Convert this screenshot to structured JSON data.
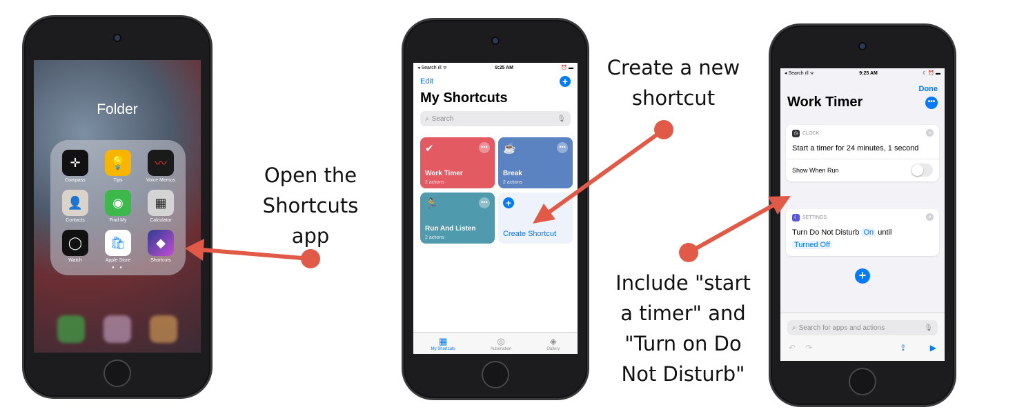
{
  "phone1": {
    "folder_title": "Folder",
    "apps": [
      {
        "label": "Compass",
        "icon": "compass-icon"
      },
      {
        "label": "Tips",
        "icon": "lightbulb-icon"
      },
      {
        "label": "Voice Memos",
        "icon": "waveform-icon"
      },
      {
        "label": "Contacts",
        "icon": "contacts-icon"
      },
      {
        "label": "Find My",
        "icon": "find-my-icon"
      },
      {
        "label": "Calculator",
        "icon": "calculator-icon"
      },
      {
        "label": "Watch",
        "icon": "watch-icon"
      },
      {
        "label": "Apple Store",
        "icon": "shopping-bag-icon"
      },
      {
        "label": "Shortcuts",
        "icon": "shortcuts-icon"
      }
    ]
  },
  "phone2": {
    "status": {
      "left": "◂ Search ıll ᯤ",
      "time": "9:25 AM",
      "right": "⏰ ▬"
    },
    "edit_label": "Edit",
    "title": "My Shortcuts",
    "search_placeholder": "Search",
    "shortcuts": [
      {
        "name": "Work Timer",
        "sub": "2 actions",
        "color": "#e35a62"
      },
      {
        "name": "Break",
        "sub": "2 actions",
        "color": "#5b83c2"
      },
      {
        "name": "Run And Listen",
        "sub": "2 actions",
        "color": "#4f9aac"
      }
    ],
    "create_label": "Create Shortcut",
    "tabs": [
      {
        "label": "My Shortcuts",
        "icon": "grid-icon"
      },
      {
        "label": "Automation",
        "icon": "clock-check-icon"
      },
      {
        "label": "Gallery",
        "icon": "layers-icon"
      }
    ]
  },
  "phone3": {
    "status": {
      "left": "◂ Search ıll ᯤ",
      "time": "9:25 AM",
      "right": "☾ ⏰ ▬"
    },
    "done_label": "Done",
    "title": "Work Timer",
    "card1": {
      "app": "CLOCK",
      "text": "Start a timer for 24 minutes, 1 second",
      "option": "Show When Run"
    },
    "card2": {
      "app": "SETTINGS",
      "text_a": "Turn Do Not Disturb",
      "pill_on": "On",
      "text_b": "until",
      "pill_off": "Turned Off"
    },
    "search_placeholder": "Search for apps and actions"
  },
  "captions": {
    "open": [
      "Open the",
      "Shortcuts",
      "app"
    ],
    "create": [
      "Create a new",
      "shortcut"
    ],
    "include": [
      "Include \"start",
      "a timer\" and",
      "\"Turn on Do",
      "Not Disturb\""
    ]
  },
  "colors": {
    "arrow": "#e05a47",
    "ios_blue": "#007aff"
  }
}
